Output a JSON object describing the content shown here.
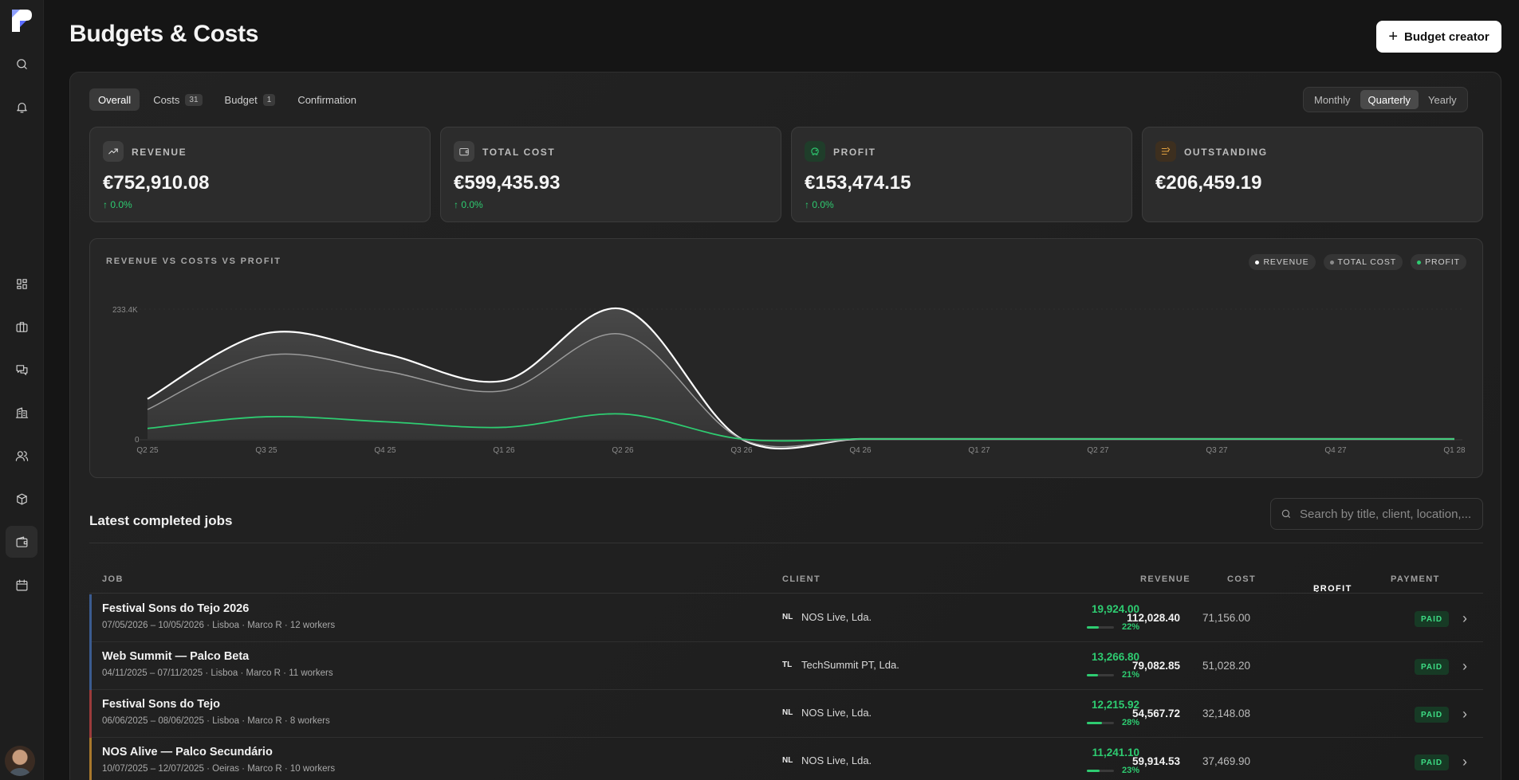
{
  "page": {
    "title": "Budgets & Costs",
    "creator_label": "Budget creator"
  },
  "tabs": [
    {
      "label": "Overall",
      "count": ""
    },
    {
      "label": "Costs",
      "count": "31"
    },
    {
      "label": "Budget",
      "count": "1"
    },
    {
      "label": "Confirmation",
      "count": ""
    }
  ],
  "period": {
    "options": [
      "Monthly",
      "Quarterly",
      "Yearly"
    ],
    "selected": "Quarterly"
  },
  "kpis": [
    {
      "label": "REVENUE",
      "value": "€752,910.08",
      "change": "↑ 0.0%",
      "icon": "trending-up-icon"
    },
    {
      "label": "TOTAL COST",
      "value": "€599,435.93",
      "change": "↑ 0.0%",
      "icon": "wallet-icon"
    },
    {
      "label": "PROFIT",
      "value": "€153,474.15",
      "change": "↑ 0.0%",
      "icon": "piggy-bank-icon"
    },
    {
      "label": "OUTSTANDING",
      "value": "€206,459.19",
      "change": "",
      "icon": "hourglass-icon"
    }
  ],
  "colors": {
    "revenue": "#ffffff",
    "cost": "#9a9a9a",
    "profit": "#2ecc71",
    "paid_bg": "#173a25"
  },
  "chart_data": {
    "type": "area",
    "title": "REVENUE VS COSTS VS PROFIT",
    "legend": [
      "REVENUE",
      "TOTAL COST",
      "PROFIT"
    ],
    "legend_placement": "top-right",
    "ytick_labels": [
      "233.4K",
      "0"
    ],
    "ylim": [
      0,
      233400
    ],
    "categories": [
      "Q2 25",
      "Q3 25",
      "Q4 25",
      "Q1 26",
      "Q2 26",
      "Q3 26",
      "Q4 26",
      "Q1 27",
      "Q2 27",
      "Q3 27",
      "Q4 27",
      "Q1 28"
    ],
    "series": [
      {
        "name": "REVENUE",
        "values": [
          72000,
          190000,
          153000,
          105000,
          233400,
          0,
          0,
          0,
          0,
          0,
          0,
          0
        ]
      },
      {
        "name": "TOTAL COST",
        "values": [
          53000,
          150000,
          122000,
          87000,
          188000,
          0,
          0,
          0,
          0,
          0,
          0,
          0
        ]
      },
      {
        "name": "PROFIT",
        "values": [
          19000,
          40000,
          31000,
          21000,
          45000,
          0,
          0,
          0,
          0,
          0,
          0,
          0
        ]
      }
    ]
  },
  "jobs": {
    "title": "Latest completed jobs",
    "search_placeholder": "Search by title, client, location,...",
    "headers": {
      "job": "JOB",
      "client": "CLIENT",
      "revenue": "REVENUE",
      "cost": "COST",
      "profit": "PROFIT",
      "payment": "PAYMENT"
    },
    "rows": [
      {
        "title": "Festival Sons do Tejo 2026",
        "meta": "07/05/2026 – 10/05/2026 · Lisboa · Marco R · 12 workers",
        "initials": "NL",
        "client": "NOS Live, Lda.",
        "revenue": "112,028.40",
        "cost": "71,156.00",
        "profit": "19,924.00",
        "pct": "22%",
        "pct_value": 22,
        "status": "PAID",
        "accent": "#3b5b8f"
      },
      {
        "title": "Web Summit — Palco Beta",
        "meta": "04/11/2025 – 07/11/2025 · Lisboa · Marco R · 11 workers",
        "initials": "TL",
        "client": "TechSummit PT, Lda.",
        "revenue": "79,082.85",
        "cost": "51,028.20",
        "profit": "13,266.80",
        "pct": "21%",
        "pct_value": 21,
        "status": "PAID",
        "accent": "#3b5b8f"
      },
      {
        "title": "Festival Sons do Tejo",
        "meta": "06/06/2025 – 08/06/2025 · Lisboa · Marco R · 8 workers",
        "initials": "NL",
        "client": "NOS Live, Lda.",
        "revenue": "54,567.72",
        "cost": "32,148.08",
        "profit": "12,215.92",
        "pct": "28%",
        "pct_value": 28,
        "status": "PAID",
        "accent": "#9b3b3b"
      },
      {
        "title": "NOS Alive — Palco Secundário",
        "meta": "10/07/2025 – 12/07/2025 · Oeiras · Marco R · 10 workers",
        "initials": "NL",
        "client": "NOS Live, Lda.",
        "revenue": "59,914.53",
        "cost": "37,469.90",
        "profit": "11,241.10",
        "pct": "23%",
        "pct_value": 23,
        "status": "PAID",
        "accent": "#a8782c"
      }
    ]
  },
  "sidebar": {
    "icons": [
      "search-icon",
      "bell-icon",
      "dashboard-icon",
      "briefcase-icon",
      "messages-icon",
      "building-icon",
      "users-icon",
      "box-icon",
      "wallet-icon",
      "calendar-icon"
    ]
  }
}
